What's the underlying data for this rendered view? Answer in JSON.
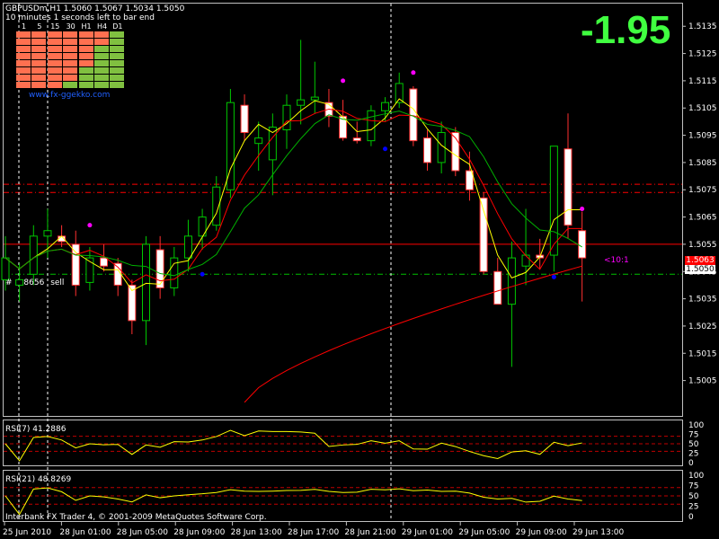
{
  "header": {
    "symbol_line": "GBPUSDm,H1  1.5060 1.5067 1.5034 1.5050",
    "countdown": "10 minutes 1 seconds left to bar end",
    "signal_value": "-1.95"
  },
  "gekko_panel": {
    "timeframes": [
      "1",
      "5",
      "15",
      "30",
      "H1",
      "H4",
      "D1"
    ],
    "url": "www.fx-ggekko.com"
  },
  "main_chart": {
    "trade_label_prefix": "#",
    "trade_label_id": "8656",
    "trade_label_action": "sell",
    "line_label": "<10:1",
    "current_price_box": "1.5063",
    "bid_box": "1.5050",
    "colors": {
      "up": "#00c800",
      "down": "#ffffff",
      "ma_fast": "#ffff00",
      "ma_mid": "#ff0000",
      "ma_slow": "#00a000",
      "dot": "#ff00ff",
      "blue_dot": "#0000ff"
    }
  },
  "rsi7": {
    "label": "RSI(7) 41.2886"
  },
  "rsi21": {
    "label": "RSI(21) 48.8269"
  },
  "footer": {
    "copyright": "Interbank FX Trader 4, © 2001-2009 MetaQuotes Software Corp."
  },
  "chart_data": {
    "type": "candlestick",
    "title": "GBPUSDm,H1",
    "y_axis_ticks": [
      "1.5135",
      "1.5125",
      "1.5115",
      "1.5105",
      "1.5095",
      "1.5085",
      "1.5075",
      "1.5065",
      "1.5055",
      "1.5045",
      "1.5035",
      "1.5025",
      "1.5015",
      "1.5005"
    ],
    "ylim": [
      1.4993,
      1.5142
    ],
    "rsi_ticks": [
      "100",
      "75",
      "50",
      "25",
      "0"
    ],
    "x_tick_labels": [
      "25 Jun 2010",
      "28 Jun 01:00",
      "28 Jun 05:00",
      "28 Jun 09:00",
      "28 Jun 13:00",
      "28 Jun 17:00",
      "28 Jun 21:00",
      "29 Jun 01:00",
      "29 Jun 05:00",
      "29 Jun 09:00",
      "29 Jun 13:00"
    ],
    "candles": [
      {
        "o": 1.5042,
        "h": 1.5058,
        "l": 1.5038,
        "c": 1.505
      },
      {
        "o": 1.504,
        "h": 1.5048,
        "l": 1.5034,
        "c": 1.5042
      },
      {
        "o": 1.5044,
        "h": 1.5062,
        "l": 1.504,
        "c": 1.5058
      },
      {
        "o": 1.5058,
        "h": 1.5068,
        "l": 1.505,
        "c": 1.506
      },
      {
        "o": 1.5058,
        "h": 1.5062,
        "l": 1.5054,
        "c": 1.5056
      },
      {
        "o": 1.5055,
        "h": 1.506,
        "l": 1.5036,
        "c": 1.504
      },
      {
        "o": 1.5041,
        "h": 1.5054,
        "l": 1.5038,
        "c": 1.505
      },
      {
        "o": 1.505,
        "h": 1.5055,
        "l": 1.5045,
        "c": 1.5047
      },
      {
        "o": 1.5048,
        "h": 1.505,
        "l": 1.5036,
        "c": 1.504
      },
      {
        "o": 1.504,
        "h": 1.5042,
        "l": 1.5022,
        "c": 1.5027
      },
      {
        "o": 1.5027,
        "h": 1.5058,
        "l": 1.5018,
        "c": 1.5055
      },
      {
        "o": 1.5053,
        "h": 1.5058,
        "l": 1.5035,
        "c": 1.5039
      },
      {
        "o": 1.5039,
        "h": 1.5054,
        "l": 1.5036,
        "c": 1.505
      },
      {
        "o": 1.505,
        "h": 1.5064,
        "l": 1.5045,
        "c": 1.5058
      },
      {
        "o": 1.5058,
        "h": 1.5068,
        "l": 1.5053,
        "c": 1.5065
      },
      {
        "o": 1.5062,
        "h": 1.508,
        "l": 1.506,
        "c": 1.5076
      },
      {
        "o": 1.5075,
        "h": 1.5112,
        "l": 1.5072,
        "c": 1.5107
      },
      {
        "o": 1.5106,
        "h": 1.511,
        "l": 1.5093,
        "c": 1.5096
      },
      {
        "o": 1.5092,
        "h": 1.51,
        "l": 1.5082,
        "c": 1.5094
      },
      {
        "o": 1.5086,
        "h": 1.5103,
        "l": 1.5073,
        "c": 1.5098
      },
      {
        "o": 1.5097,
        "h": 1.511,
        "l": 1.509,
        "c": 1.5106
      },
      {
        "o": 1.5106,
        "h": 1.513,
        "l": 1.5099,
        "c": 1.5108
      },
      {
        "o": 1.5108,
        "h": 1.5122,
        "l": 1.5103,
        "c": 1.5109
      },
      {
        "o": 1.5107,
        "h": 1.5112,
        "l": 1.5098,
        "c": 1.5102
      },
      {
        "o": 1.5102,
        "h": 1.5108,
        "l": 1.5093,
        "c": 1.5094
      },
      {
        "o": 1.5094,
        "h": 1.51,
        "l": 1.5092,
        "c": 1.5093
      },
      {
        "o": 1.5093,
        "h": 1.5106,
        "l": 1.5091,
        "c": 1.5104
      },
      {
        "o": 1.5104,
        "h": 1.5109,
        "l": 1.51,
        "c": 1.5107
      },
      {
        "o": 1.5107,
        "h": 1.5118,
        "l": 1.5105,
        "c": 1.5114
      },
      {
        "o": 1.5112,
        "h": 1.5113,
        "l": 1.5091,
        "c": 1.5093
      },
      {
        "o": 1.5094,
        "h": 1.5097,
        "l": 1.5082,
        "c": 1.5085
      },
      {
        "o": 1.5085,
        "h": 1.51,
        "l": 1.5081,
        "c": 1.5096
      },
      {
        "o": 1.5096,
        "h": 1.5098,
        "l": 1.508,
        "c": 1.5082
      },
      {
        "o": 1.5082,
        "h": 1.5089,
        "l": 1.5071,
        "c": 1.5075
      },
      {
        "o": 1.5072,
        "h": 1.5074,
        "l": 1.5044,
        "c": 1.5045
      },
      {
        "o": 1.5045,
        "h": 1.505,
        "l": 1.5033,
        "c": 1.5033
      },
      {
        "o": 1.5033,
        "h": 1.5056,
        "l": 1.501,
        "c": 1.505
      },
      {
        "o": 1.5047,
        "h": 1.5068,
        "l": 1.504,
        "c": 1.5051
      },
      {
        "o": 1.5051,
        "h": 1.5057,
        "l": 1.5046,
        "c": 1.505
      },
      {
        "o": 1.5051,
        "h": 1.5064,
        "l": 1.5045,
        "c": 1.5091
      },
      {
        "o": 1.509,
        "h": 1.5103,
        "l": 1.5057,
        "c": 1.5062
      },
      {
        "o": 1.506,
        "h": 1.5067,
        "l": 1.5034,
        "c": 1.505
      }
    ]
  }
}
